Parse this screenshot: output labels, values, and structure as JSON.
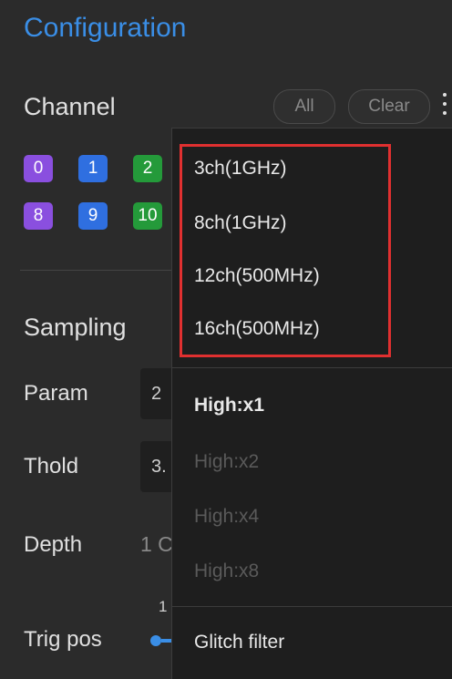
{
  "panel": {
    "title": "Configuration",
    "channel": {
      "heading": "Channel",
      "all_label": "All",
      "clear_label": "Clear",
      "chips": [
        {
          "label": "0",
          "color": "#8a4fdf"
        },
        {
          "label": "1",
          "color": "#2f6fe0"
        },
        {
          "label": "2",
          "color": "#249a3a"
        },
        {
          "label": "8",
          "color": "#8a4fdf"
        },
        {
          "label": "9",
          "color": "#2f6fe0"
        },
        {
          "label": "10",
          "color": "#249a3a"
        }
      ]
    },
    "sampling": {
      "heading": "Sampling",
      "param_label": "Param",
      "param_value": "2",
      "thold_label": "Thold",
      "thold_value": "3.",
      "depth_label": "Depth",
      "depth_value": "1 C",
      "trigpos_label": "Trig pos",
      "trigpos_value": "1"
    }
  },
  "menu": {
    "channel_modes": [
      "3ch(1GHz)",
      "8ch(1GHz)",
      "12ch(500MHz)",
      "16ch(500MHz)"
    ],
    "gain_options": [
      {
        "label": "High:x1",
        "enabled": true
      },
      {
        "label": "High:x2",
        "enabled": false
      },
      {
        "label": "High:x4",
        "enabled": false
      },
      {
        "label": "High:x8",
        "enabled": false
      }
    ],
    "glitch_filter": "Glitch filter"
  },
  "colors": {
    "accent": "#3a8ee6",
    "highlight_border": "#e03030"
  }
}
